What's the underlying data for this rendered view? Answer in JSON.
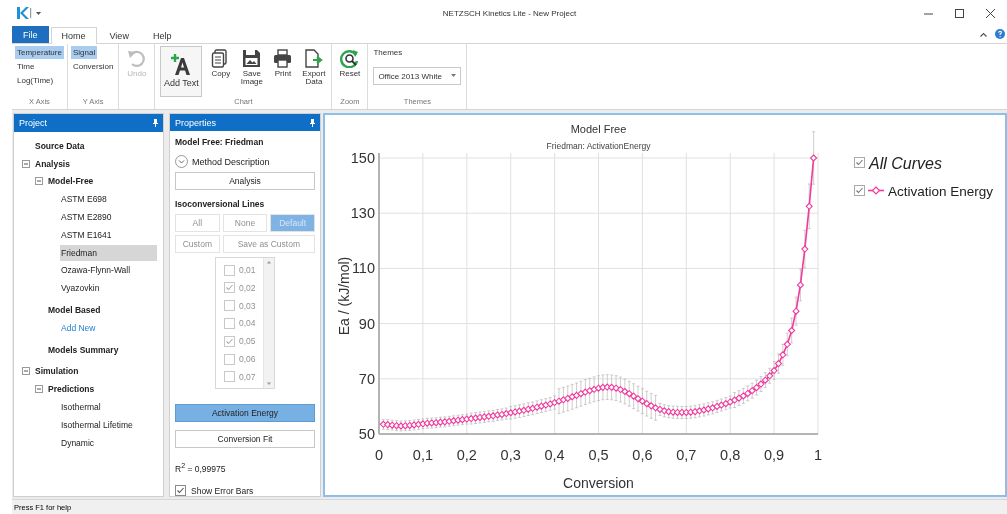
{
  "window": {
    "title": "NETZSCH Kinetics Lite - New Project"
  },
  "menu_tabs": [
    {
      "label": "File",
      "kind": "backstage",
      "selected": false
    },
    {
      "label": "Home",
      "kind": "tab",
      "selected": true
    },
    {
      "label": "View",
      "kind": "tab",
      "selected": false
    },
    {
      "label": "Help",
      "kind": "tab",
      "selected": false
    }
  ],
  "ribbon": [
    {
      "kind": "options",
      "label": "X Axis",
      "options": [
        {
          "label": "Temperature",
          "selected": true
        },
        {
          "label": "Time",
          "selected": false
        },
        {
          "label": "Log(Time)",
          "selected": false
        }
      ]
    },
    {
      "kind": "options",
      "label": "Y Axis",
      "options": [
        {
          "label": "Signal",
          "selected": true
        },
        {
          "label": "Conversion",
          "selected": false
        }
      ]
    },
    {
      "kind": "buttons",
      "buttons": [
        {
          "label": "Undo",
          "kind": "undo",
          "disabled": true
        }
      ]
    },
    {
      "kind": "buttons",
      "label": "Chart",
      "buttons": [
        {
          "label": "Add Text",
          "kind": "add-text",
          "disabled": false
        },
        {
          "label": "Copy",
          "kind": "copy",
          "disabled": false
        },
        {
          "label": "Save Image",
          "kind": "save-image",
          "disabled": false
        },
        {
          "label": "Print",
          "kind": "print",
          "disabled": false
        },
        {
          "label": "Export Data",
          "kind": "export",
          "disabled": false
        }
      ]
    },
    {
      "kind": "buttons",
      "label": "Zoom",
      "buttons": [
        {
          "label": "Reset",
          "kind": "reset",
          "disabled": false
        }
      ]
    },
    {
      "kind": "dropdown",
      "label": "Themes",
      "caption": "Themes",
      "value": "Office 2013 White"
    }
  ],
  "project": {
    "title": "Project",
    "tree": [
      {
        "label": "Source Data",
        "kind": "header"
      },
      {
        "label": "Analysis",
        "kind": "header",
        "expanded": true,
        "children": [
          {
            "label": "Model-Free",
            "kind": "header",
            "expanded": true,
            "children": [
              {
                "label": "ASTM E698",
                "kind": "item",
                "selected": false
              },
              {
                "label": "ASTM E2890",
                "kind": "item",
                "selected": false
              },
              {
                "label": "ASTM E1641",
                "kind": "item",
                "selected": false
              },
              {
                "label": "Friedman",
                "kind": "item",
                "selected": true
              },
              {
                "label": "Ozawa-Flynn-Wall",
                "kind": "item",
                "selected": false
              },
              {
                "label": "Vyazovkin",
                "kind": "item",
                "selected": false
              }
            ]
          },
          {
            "label": "Model Based",
            "kind": "header",
            "children": [
              {
                "label": "Add New",
                "kind": "link"
              }
            ]
          },
          {
            "label": "Models Summary",
            "kind": "header"
          }
        ]
      },
      {
        "label": "Simulation",
        "kind": "header",
        "expanded": true,
        "children": [
          {
            "label": "Predictions",
            "kind": "header",
            "expanded": true,
            "children": [
              {
                "label": "Isothermal",
                "kind": "item",
                "selected": false
              },
              {
                "label": "Isothermal Lifetime",
                "kind": "item",
                "selected": false
              },
              {
                "label": "Dynamic",
                "kind": "item",
                "selected": false
              }
            ]
          }
        ]
      }
    ]
  },
  "properties": {
    "title": "Properties",
    "heading": "Model Free: Friedman",
    "method_description": {
      "label": "Method Description",
      "expanded": false
    },
    "analysis_button": "Analysis",
    "lines_heading": "Isoconversional Lines",
    "line_buttons": [
      {
        "label": "All",
        "selected": false,
        "disabled": true
      },
      {
        "label": "None",
        "selected": false,
        "disabled": true
      },
      {
        "label": "Default",
        "selected": true,
        "disabled": true
      },
      {
        "label": "Custom",
        "selected": false,
        "disabled": true
      },
      {
        "label": "Save as Custom",
        "selected": false,
        "disabled": true
      }
    ],
    "lines": [
      {
        "label": "0,01",
        "checked": false,
        "disabled": true
      },
      {
        "label": "0,02",
        "checked": true,
        "disabled": true
      },
      {
        "label": "0,03",
        "checked": false,
        "disabled": true
      },
      {
        "label": "0,04",
        "checked": false,
        "disabled": true
      },
      {
        "label": "0,05",
        "checked": true,
        "disabled": true
      },
      {
        "label": "0,06",
        "checked": false,
        "disabled": true
      },
      {
        "label": "0,07",
        "checked": false,
        "disabled": true
      }
    ],
    "result_buttons": [
      {
        "label": "Activation Energy",
        "selected": true
      },
      {
        "label": "Conversion Fit",
        "selected": false
      }
    ],
    "r_squared": "R$^{2}$ = 0,99975",
    "show_error_bars": {
      "label": "Show Error Bars",
      "checked": true
    }
  },
  "chart_panel": {
    "subtitle": "Friedman: ActivationEnergy",
    "legend": [
      {
        "label": "All Curves",
        "kind": "group",
        "checked": true
      },
      {
        "kind": "series",
        "checked": true
      }
    ],
    "chart_data": {
      "type": "line",
      "title": "Model Free",
      "xlabel": "Conversion",
      "ylabel": "Ea / (kJ/mol)",
      "x": [
        0.01,
        0.02,
        0.03,
        0.04,
        0.05,
        0.06,
        0.07,
        0.08,
        0.09,
        0.1,
        0.11,
        0.12,
        0.13,
        0.14,
        0.15,
        0.16,
        0.17,
        0.18,
        0.19,
        0.2,
        0.21,
        0.22,
        0.23,
        0.24,
        0.25,
        0.26,
        0.27,
        0.28,
        0.29,
        0.3,
        0.31,
        0.32,
        0.33,
        0.34,
        0.35,
        0.36,
        0.37,
        0.38,
        0.39,
        0.4,
        0.41,
        0.42,
        0.43,
        0.44,
        0.45,
        0.46,
        0.47,
        0.48,
        0.49,
        0.5,
        0.51,
        0.52,
        0.53,
        0.54,
        0.55,
        0.56,
        0.57,
        0.58,
        0.59,
        0.6,
        0.61,
        0.62,
        0.63,
        0.64,
        0.65,
        0.66,
        0.67,
        0.68,
        0.69,
        0.7,
        0.71,
        0.72,
        0.73,
        0.74,
        0.75,
        0.76,
        0.77,
        0.78,
        0.79,
        0.8,
        0.81,
        0.82,
        0.83,
        0.84,
        0.85,
        0.86,
        0.87,
        0.88,
        0.89,
        0.9,
        0.91,
        0.92,
        0.93,
        0.94,
        0.95,
        0.96,
        0.97,
        0.98,
        0.99
      ],
      "grid": true,
      "series": [
        {
          "name": "Activation Energy",
          "color": "#f2399c",
          "marker": "diamond",
          "errors": [
            1.8,
            1.8,
            1.8,
            1.8,
            1.8,
            1.8,
            1.8,
            1.8,
            1.8,
            1.8,
            1.8,
            1.8,
            1.8,
            1.8,
            1.8,
            1.8,
            1.8,
            1.8,
            1.8,
            1.8,
            2.0,
            2.0,
            2.0,
            2.0,
            2.0,
            2.0,
            2.0,
            2.0,
            2.0,
            2.3,
            2.3,
            2.3,
            2.3,
            2.3,
            2.3,
            2.3,
            2.3,
            2.3,
            2.3,
            2.4,
            4.5,
            4.5,
            4.5,
            4.5,
            4.5,
            4.5,
            4.5,
            4.5,
            4.5,
            4.5,
            4.5,
            4.5,
            4.5,
            4.5,
            4.5,
            4.5,
            4.5,
            4.5,
            4.5,
            4.5,
            4.5,
            4.5,
            4.5,
            2.2,
            2.2,
            2.2,
            2.2,
            2.2,
            2.2,
            2.2,
            2.2,
            2.2,
            2.2,
            2.2,
            2.2,
            2.2,
            2.2,
            2.2,
            2.2,
            2.2,
            2.7,
            2.7,
            2.7,
            2.7,
            2.7,
            2.7,
            2.7,
            2.7,
            2.7,
            3.3,
            3.5,
            3.8,
            4.1,
            4.5,
            5.1,
            5.8,
            6.8,
            8.1,
            9.5
          ],
          "values": [
            53.5,
            53.4,
            53.2,
            53.0,
            52.9,
            53.0,
            53.1,
            53.3,
            53.5,
            53.7,
            53.9,
            54.0,
            54.1,
            54.3,
            54.4,
            54.6,
            54.8,
            55.0,
            55.2,
            55.4,
            55.6,
            55.8,
            56.0,
            56.2,
            56.4,
            56.6,
            56.9,
            57.1,
            57.4,
            57.7,
            58.0,
            58.3,
            58.6,
            59.0,
            59.3,
            59.7,
            60.1,
            60.5,
            60.9,
            61.4,
            61.9,
            62.4,
            62.9,
            63.5,
            64.0,
            64.6,
            65.2,
            65.7,
            66.2,
            66.6,
            66.9,
            67.0,
            66.9,
            66.6,
            66.1,
            65.4,
            64.6,
            63.7,
            62.8,
            61.9,
            61.0,
            60.2,
            59.5,
            58.9,
            58.4,
            58.1,
            57.9,
            57.8,
            57.8,
            57.8,
            57.9,
            58.1,
            58.4,
            58.7,
            59.1,
            59.5,
            60.0,
            60.5,
            61.0,
            61.6,
            62.3,
            63.0,
            63.8,
            64.7,
            65.7,
            66.8,
            68.1,
            69.5,
            71.1,
            73.0,
            75.5,
            78.7,
            82.5,
            87.5,
            94.5,
            104.0,
            117.0,
            132.5,
            150.0
          ]
        }
      ],
      "xlim": [
        0,
        1
      ],
      "ylim": [
        50,
        150
      ],
      "xticks": [
        0,
        {
          "value": 0.1,
          "label": "0,1"
        },
        {
          "value": 0.2,
          "label": "0,2"
        },
        {
          "value": 0.3,
          "label": "0,3"
        },
        {
          "value": 0.4,
          "label": "0,4"
        },
        {
          "value": 0.5,
          "label": "0,5"
        },
        {
          "value": 0.6,
          "label": "0,6"
        },
        {
          "value": 0.7,
          "label": "0,7"
        },
        {
          "value": 0.8,
          "label": "0,8"
        },
        {
          "value": 0.9,
          "label": "0,9"
        },
        1
      ],
      "yticks": [
        50,
        70,
        90,
        110,
        130,
        150
      ]
    }
  },
  "status_bar": "Press F1 for help"
}
